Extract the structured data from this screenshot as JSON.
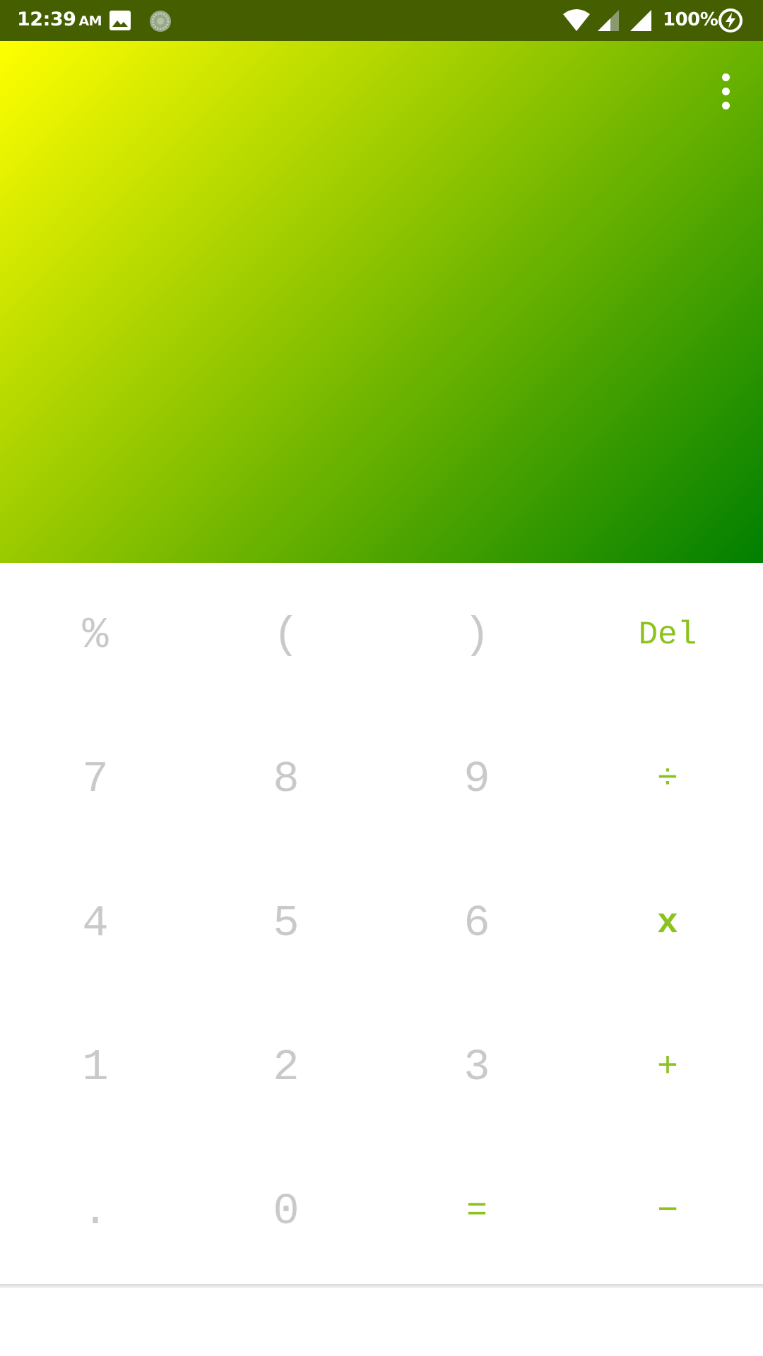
{
  "status_bar": {
    "time": "12:39",
    "ampm": "AM",
    "battery": "100%",
    "icons": [
      "image-icon",
      "loading-icon",
      "wifi-icon",
      "signal-icon",
      "signal-full-icon",
      "charging-icon"
    ],
    "background_color": "#445e00"
  },
  "display": {
    "gradient_colors": [
      "#ffff00",
      "#8fc400",
      "#007f00"
    ],
    "menu_icon": "more-vert-icon"
  },
  "keypad": {
    "rows": [
      [
        "%",
        "(",
        ")",
        "Del"
      ],
      [
        "7",
        "8",
        "9",
        "÷"
      ],
      [
        "4",
        "5",
        "6",
        "x"
      ],
      [
        "1",
        "2",
        "3",
        "+"
      ],
      [
        ".",
        "0",
        "=",
        "−"
      ]
    ],
    "digit_color": "#c9c9c9",
    "operator_color": "#8bc21d"
  }
}
